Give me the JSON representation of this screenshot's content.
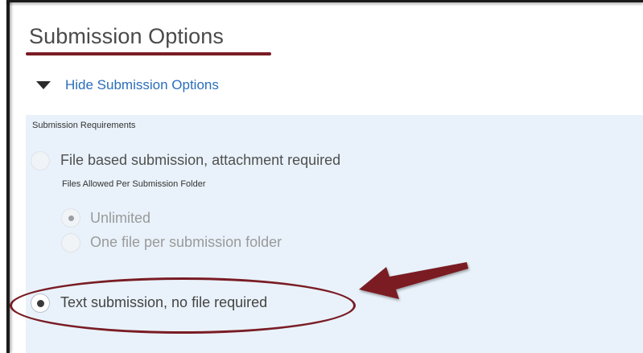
{
  "section": {
    "title": "Submission Options",
    "toggle_label": "Hide Submission Options"
  },
  "requirements": {
    "label": "Submission Requirements",
    "options": [
      {
        "label": "File based submission, attachment required",
        "selected": false
      },
      {
        "label": "Text submission, no file required",
        "selected": true
      }
    ],
    "files_allowed": {
      "label": "Files Allowed Per Submission Folder",
      "options": [
        {
          "label": "Unlimited",
          "selected": true
        },
        {
          "label": "One file per submission folder",
          "selected": false
        }
      ]
    }
  },
  "colors": {
    "accent": "#7a1c24",
    "link": "#2a6ebb",
    "panel": "#e9f2fa"
  },
  "icons": {
    "toggle": "caret-down-icon",
    "annotation": "arrow-left-icon"
  }
}
